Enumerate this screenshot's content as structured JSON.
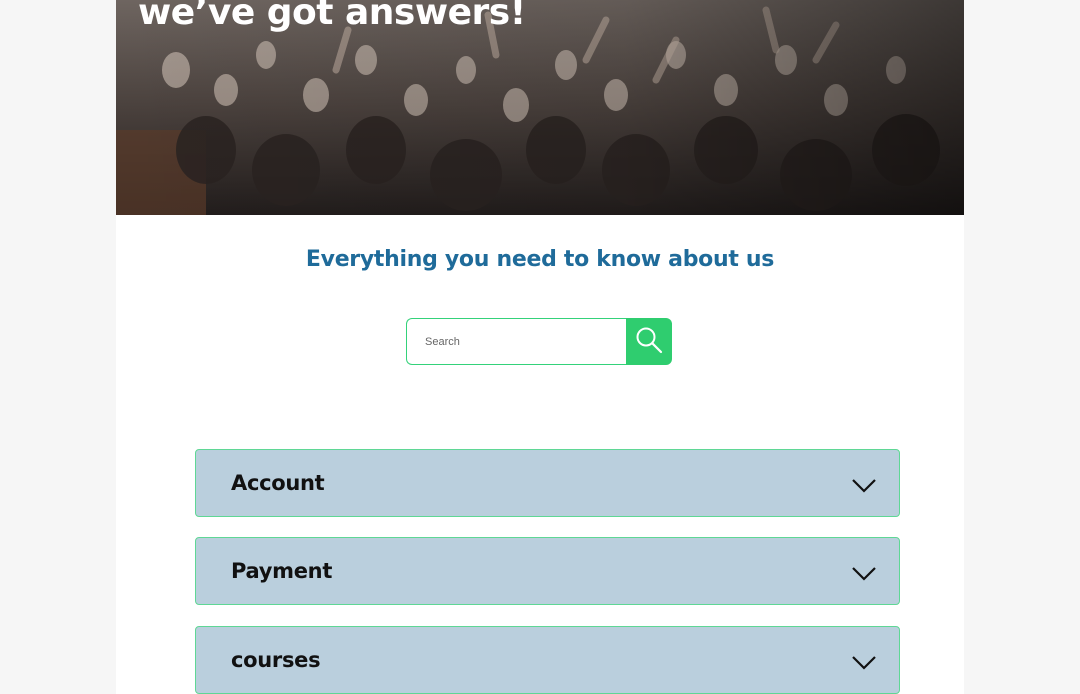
{
  "hero": {
    "title": "we’ve got answers!"
  },
  "faq": {
    "subtitle": "Everything you need to know about us"
  },
  "search": {
    "placeholder": "Search",
    "button_icon": "search-icon",
    "button_color": "#2fcd6f"
  },
  "categories": [
    {
      "label": "Account",
      "icon": "chevron-down-icon"
    },
    {
      "label": "Payment",
      "icon": "chevron-down-icon"
    },
    {
      "label": "courses",
      "icon": "chevron-down-icon"
    }
  ],
  "colors": {
    "accent_green": "#2fcd6f",
    "heading_blue": "#1f6b9a",
    "accordion_bg": "#bacfdd"
  }
}
